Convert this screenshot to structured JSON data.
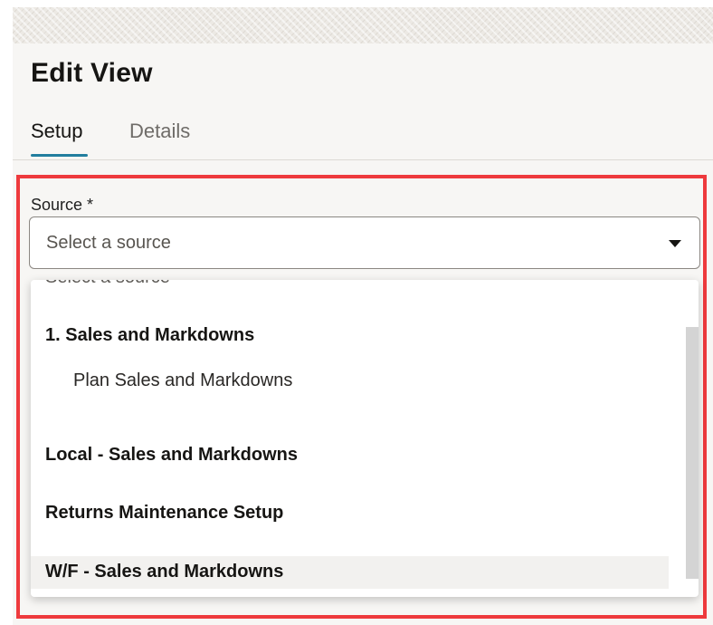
{
  "header": {
    "title": "Edit View"
  },
  "tabs": [
    {
      "label": "Setup",
      "selected": true
    },
    {
      "label": "Details",
      "selected": false
    }
  ],
  "source_field": {
    "label": "Source *",
    "placeholder": "Select a source",
    "icon": "caret-down-icon"
  },
  "dropdown": {
    "partial_first_item": "Select a source",
    "items": [
      {
        "label": "1. Sales and Markdowns",
        "kind": "group"
      },
      {
        "label": "Plan Sales and Markdowns",
        "kind": "option"
      },
      {
        "label": "Local - Sales and Markdowns",
        "kind": "group"
      },
      {
        "label": "Returns Maintenance Setup",
        "kind": "group"
      },
      {
        "label": "W/F - Sales and Markdowns",
        "kind": "group",
        "hovered": true
      }
    ]
  },
  "colors": {
    "accent": "#227e9e",
    "highlight_border": "#ee3a3d",
    "panel_bg": "#f7f6f4"
  }
}
